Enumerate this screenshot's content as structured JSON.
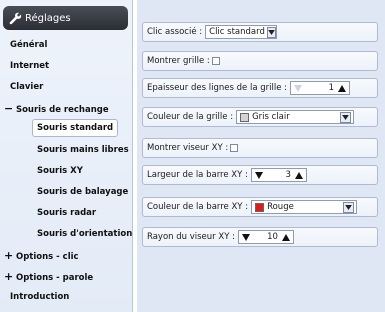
{
  "sidebar": {
    "title": "Réglages",
    "items": [
      {
        "label": "Général"
      },
      {
        "label": "Internet"
      },
      {
        "label": "Clavier"
      },
      {
        "label": "Souris de rechange",
        "expander": "−"
      },
      {
        "label": "Souris standard",
        "selected": true
      },
      {
        "label": "Souris mains libres"
      },
      {
        "label": "Souris XY"
      },
      {
        "label": "Souris de balayage"
      },
      {
        "label": "Souris radar"
      },
      {
        "label": "Souris d'orientation"
      },
      {
        "label": "Options - clic",
        "expander": "+"
      },
      {
        "label": "Options - parole",
        "expander": "+"
      },
      {
        "label": "Introduction"
      }
    ]
  },
  "settings": {
    "clic_associe": {
      "label": "Clic associé :",
      "value": "Clic standard"
    },
    "montrer_grille": {
      "label": "Montrer grille :",
      "checked": false
    },
    "epaisseur": {
      "label": "Epaisseur des lignes de la grille :",
      "value": "1"
    },
    "couleur_grille": {
      "label": "Couleur de la grille :",
      "value": "Gris clair",
      "swatch": "#d4d4d4"
    },
    "montrer_viseur": {
      "label": "Montrer viseur XY :",
      "checked": false
    },
    "largeur_barre": {
      "label": "Largeur de la barre XY :",
      "value": "3"
    },
    "couleur_barre": {
      "label": "Couleur de la barre XY :",
      "value": "Rouge",
      "swatch": "#e21a1a"
    },
    "rayon_viseur": {
      "label": "Rayon du viseur XY :",
      "value": "10"
    }
  },
  "colors": {
    "header_bg": "#333640",
    "panel_bg": "#dfe7f4"
  }
}
